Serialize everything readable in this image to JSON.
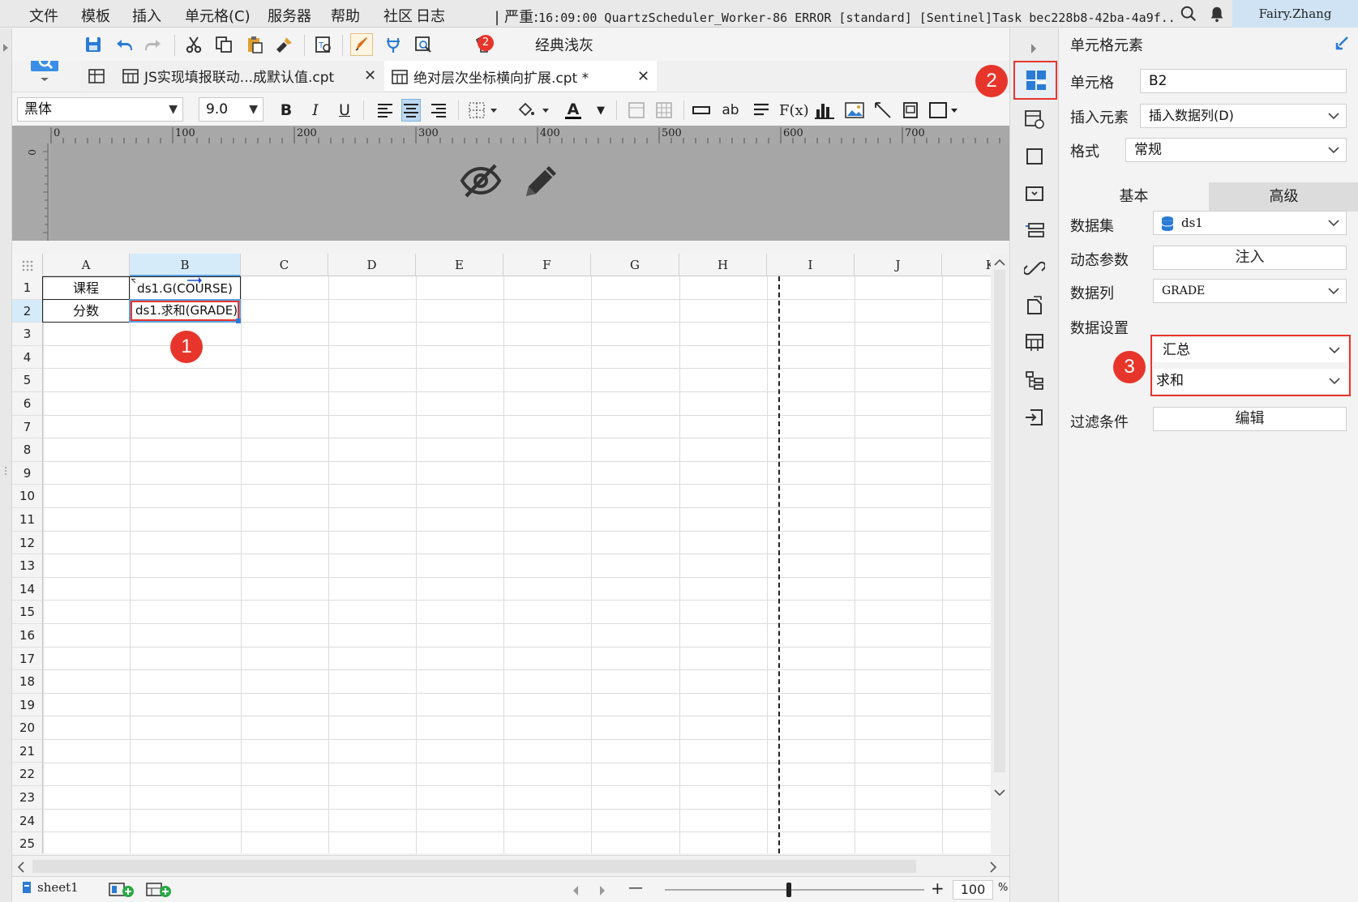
{
  "menu": [
    "文件",
    "模板",
    "插入",
    "单元格(C)",
    "服务器",
    "帮助",
    "社区",
    "日志"
  ],
  "log_message": {
    "label": "严重:",
    "text": "16:09:00 QuartzScheduler_Worker-86 ERROR [standard] [Sentinel]Task bec228b8-42ba-4a9f..."
  },
  "user": "Fairy.Zhang",
  "toolbar": {
    "badge_count": "2",
    "theme_label": "经典浅灰"
  },
  "tabs": [
    {
      "label": "JS实现填报联动...成默认值.cpt",
      "active": false
    },
    {
      "label": "绝对层次坐标横向扩展.cpt *",
      "active": true
    }
  ],
  "format_bar": {
    "font_family": "黑体",
    "font_size": "9.0",
    "bold": "B",
    "italic": "I",
    "underline": "U",
    "text_color_glyph": "A",
    "abc_glyph": "ab",
    "fx_glyph": "F(x)"
  },
  "ruler": {
    "ticks": [
      "0",
      "100",
      "200",
      "300",
      "400",
      "500",
      "600",
      "700"
    ],
    "left_zero": "0"
  },
  "sheet": {
    "columns": [
      "A",
      "B",
      "C",
      "D",
      "E",
      "F",
      "G",
      "H",
      "I",
      "J",
      "K"
    ],
    "selected_column": "B",
    "rows": [
      "1",
      "2",
      "3",
      "4",
      "5",
      "6",
      "7",
      "8",
      "9",
      "10",
      "11",
      "12",
      "13",
      "14",
      "15",
      "16",
      "17",
      "18",
      "19",
      "20",
      "21",
      "22",
      "23",
      "24",
      "25"
    ],
    "selected_row": "2",
    "cells": {
      "A1": "课程",
      "A2": "分数",
      "B1": "ds1.G(COURSE)",
      "B2": "ds1.求和(GRADE)"
    }
  },
  "bottom": {
    "sheet_name": "sheet1",
    "zoom_value": "100",
    "zoom_unit": "%",
    "zoom_minus": "—",
    "zoom_plus": "+"
  },
  "panel": {
    "title": "单元格元素",
    "cell_label": "单元格",
    "cell_value": "B2",
    "insert_label": "插入元素",
    "insert_value": "插入数据列(D)",
    "format_label": "格式",
    "format_value": "常规",
    "tab_basic": "基本",
    "tab_advanced": "高级",
    "dataset_label": "数据集",
    "dataset_value": "ds1",
    "dynamic_param_label": "动态参数",
    "dynamic_param_button": "注入",
    "data_column_label": "数据列",
    "data_column_value": "GRADE",
    "data_setting_label": "数据设置",
    "data_setting_mode": "汇总",
    "data_setting_func": "求和",
    "filter_label": "过滤条件",
    "filter_button": "编辑"
  },
  "markers": {
    "m1": "1",
    "m2": "2",
    "m3": "3"
  },
  "colors": {
    "accent_red": "#e8352b",
    "selection_blue": "#5aa0e0",
    "user_bg": "#cfe3f4"
  }
}
